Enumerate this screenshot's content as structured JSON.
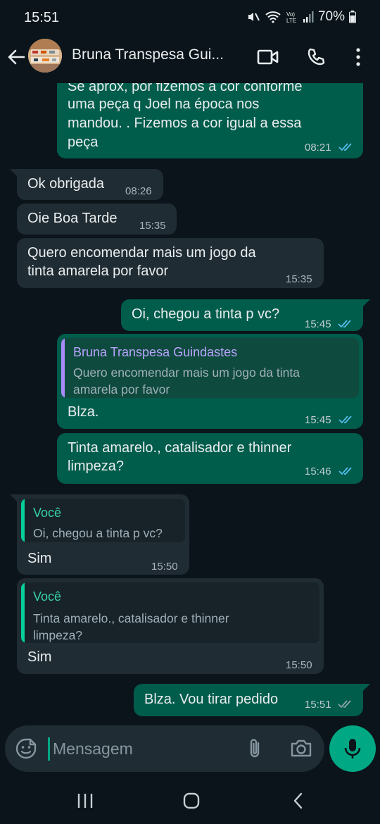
{
  "status": {
    "time": "15:51",
    "battery": "70%"
  },
  "header": {
    "contact_name": "Bruna Transpesa Gui..."
  },
  "messages": {
    "m1": {
      "lines": [
        "Se aprox, por fizemos a cor conforme",
        "uma peça  q Joel na época nos",
        "mandou.  .  Fizemos a cor igual a essa",
        "peça"
      ],
      "time": "08:21"
    },
    "m2": {
      "text": "Ok obrigada",
      "time": "08:26"
    },
    "m3": {
      "text": "Oie Boa Tarde",
      "time": "15:35"
    },
    "m4": {
      "lines": [
        "Quero encomendar mais um jogo da",
        "tinta amarela por favor"
      ],
      "time": "15:35"
    },
    "m5": {
      "text": "Oi, chegou  a tinta p vc?",
      "time": "15:45"
    },
    "m6": {
      "quote_name": "Bruna Transpesa Guindastes",
      "quote_lines": [
        "Quero encomendar mais um jogo da tinta",
        "amarela por favor"
      ],
      "text": "Blza.",
      "time": "15:45"
    },
    "m7": {
      "lines": [
        "Tinta amarelo., catalisador  e thinner",
        "limpeza?"
      ],
      "time": "15:46"
    },
    "m8": {
      "quote_name": "Você",
      "quote_lines": [
        "Oi, chegou  a tinta p vc?"
      ],
      "text": "Sim",
      "time": "15:50"
    },
    "m9": {
      "quote_name": "Você",
      "quote_lines": [
        "Tinta amarelo., catalisador  e thinner",
        "limpeza?"
      ],
      "text": "Sim",
      "time": "15:50"
    },
    "m10": {
      "text": "Blza. Vou tirar  pedido",
      "time": "15:51"
    }
  },
  "composer": {
    "placeholder": "Mensagem"
  },
  "colors": {
    "outgoing": "#005c4b",
    "incoming": "#202c33",
    "accent": "#00a884",
    "read_ticks": "#53bdeb",
    "quote_purple": "#a78bfa",
    "quote_green": "#06cf9c"
  },
  "icons": [
    "back-arrow-icon",
    "video-call-icon",
    "phone-icon",
    "more-icon",
    "emoji-icon",
    "attach-icon",
    "camera-icon",
    "mic-icon"
  ]
}
